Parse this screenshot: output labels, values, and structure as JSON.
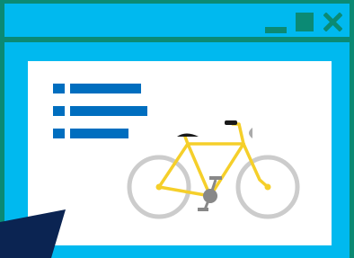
{
  "window": {
    "controls": [
      {
        "name": "minimize",
        "icon": "minimize-icon"
      },
      {
        "name": "maximize",
        "icon": "maximize-icon"
      },
      {
        "name": "close",
        "icon": "close-icon"
      }
    ]
  },
  "content": {
    "list": {
      "item_count": 3
    },
    "illustration": {
      "subject": "bicycle-icon"
    }
  },
  "colors": {
    "frame": "#0b8a74",
    "window": "#00b9ef",
    "panel": "#ffffff",
    "list": "#006ebf",
    "bike_frame": "#f5cf2a",
    "wheel": "#cccccc",
    "cursor": "#0b2452"
  }
}
